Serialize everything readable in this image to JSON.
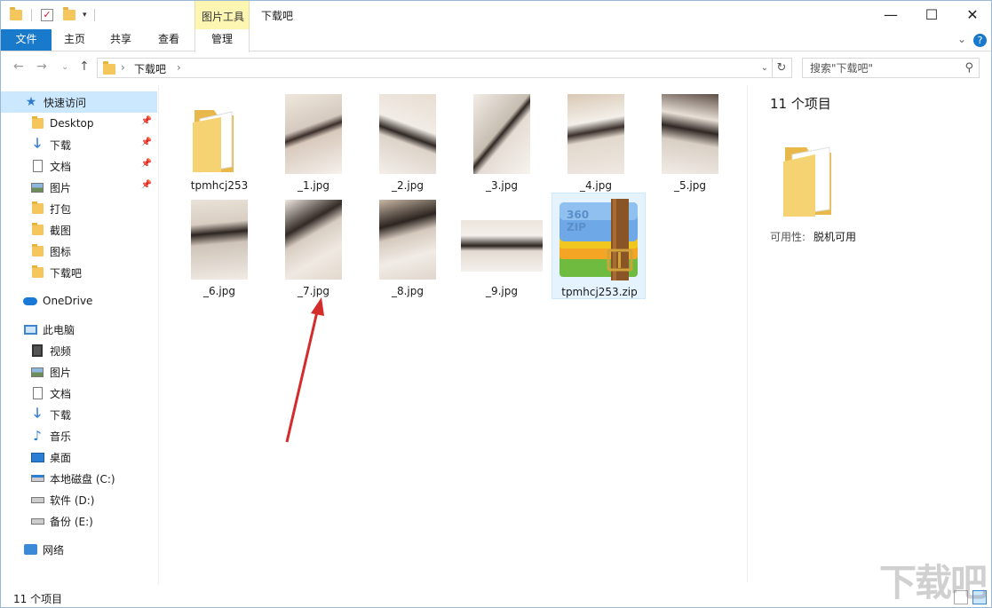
{
  "window": {
    "title": "下载吧",
    "tool_tab_group": "图片工具",
    "controls": {
      "minimize": "—",
      "maximize": "☐",
      "close": "✕"
    }
  },
  "ribbon": {
    "tabs": [
      {
        "label": "文件",
        "active": true
      },
      {
        "label": "主页"
      },
      {
        "label": "共享"
      },
      {
        "label": "查看"
      },
      {
        "label": "管理"
      }
    ],
    "expand_icon": "chevron-down-icon",
    "help_icon": "?"
  },
  "address": {
    "breadcrumbs": [
      "下载吧"
    ],
    "search_placeholder": "搜索\"下载吧\""
  },
  "nav": {
    "quick_access": "快速访问",
    "quick_items": [
      {
        "label": "Desktop",
        "icon": "folder-icon",
        "pinned": true
      },
      {
        "label": "下载",
        "icon": "download-icon",
        "pinned": true
      },
      {
        "label": "文档",
        "icon": "document-icon",
        "pinned": true
      },
      {
        "label": "图片",
        "icon": "picture-icon",
        "pinned": true
      },
      {
        "label": "打包",
        "icon": "folder-icon"
      },
      {
        "label": "截图",
        "icon": "folder-icon"
      },
      {
        "label": "图标",
        "icon": "folder-icon"
      },
      {
        "label": "下载吧",
        "icon": "folder-icon"
      }
    ],
    "onedrive": "OneDrive",
    "this_pc": "此电脑",
    "pc_items": [
      {
        "label": "视频",
        "icon": "video-icon"
      },
      {
        "label": "图片",
        "icon": "picture-icon"
      },
      {
        "label": "文档",
        "icon": "document-icon"
      },
      {
        "label": "下载",
        "icon": "download-icon"
      },
      {
        "label": "音乐",
        "icon": "music-icon"
      },
      {
        "label": "桌面",
        "icon": "desktop-icon"
      },
      {
        "label": "本地磁盘 (C:)",
        "icon": "drive-c-icon"
      },
      {
        "label": "软件 (D:)",
        "icon": "drive-icon"
      },
      {
        "label": "备份 (E:)",
        "icon": "drive-icon"
      }
    ],
    "network": "网络"
  },
  "files": [
    {
      "name": "tpmhcj253",
      "type": "folder"
    },
    {
      "name": "_1.jpg",
      "type": "image"
    },
    {
      "name": "_2.jpg",
      "type": "image"
    },
    {
      "name": "_3.jpg",
      "type": "image"
    },
    {
      "name": "_4.jpg",
      "type": "image"
    },
    {
      "name": "_5.jpg",
      "type": "image"
    },
    {
      "name": "_6.jpg",
      "type": "image"
    },
    {
      "name": "_7.jpg",
      "type": "image"
    },
    {
      "name": "_8.jpg",
      "type": "image"
    },
    {
      "name": "_9.jpg",
      "type": "image"
    },
    {
      "name": "tpmhcj253.zip",
      "type": "zip",
      "selected": true
    }
  ],
  "details": {
    "count": "11 个项目",
    "availability_label": "可用性:",
    "availability_value": "脱机可用"
  },
  "status": {
    "count": "11 个项目"
  },
  "zip_badge": "360 ZIP",
  "watermark": "下载吧",
  "annotation": {
    "color": "#d42b2b",
    "icon": "red-arrow-icon"
  }
}
